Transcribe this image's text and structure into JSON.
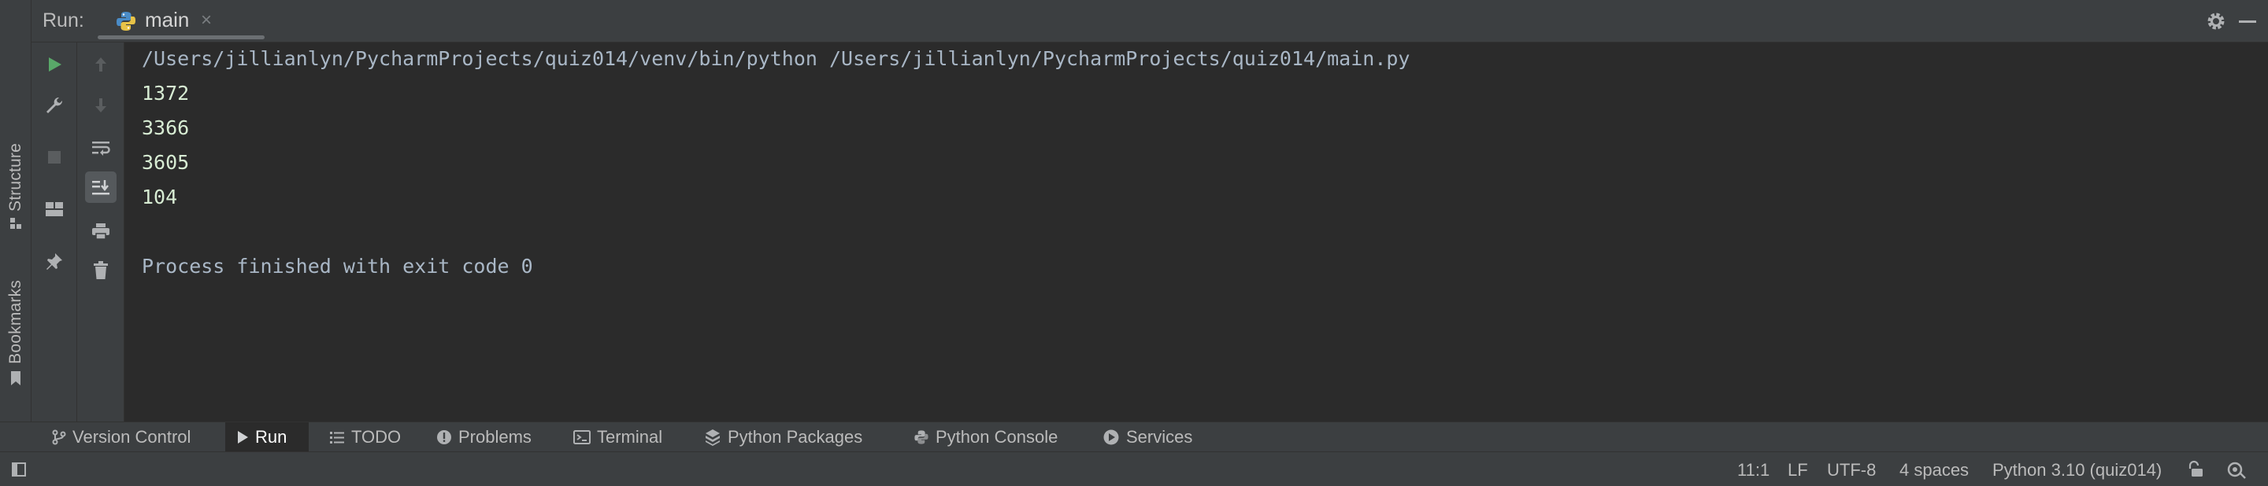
{
  "run_panel": {
    "label": "Run:",
    "tab": {
      "name": "main",
      "icon": "python-icon",
      "close": "×"
    }
  },
  "left_stripe": {
    "structure": "Structure",
    "bookmarks": "Bookmarks"
  },
  "toolbar": {
    "column1": [
      "rerun-icon",
      "wrench-icon",
      "stop-icon",
      "layout-icon",
      "pin-icon"
    ],
    "column2": [
      "arrow-up-icon",
      "arrow-down-icon",
      "soft-wrap-icon",
      "scroll-to-end-icon",
      "print-icon",
      "trash-icon"
    ]
  },
  "console": {
    "command": "/Users/jillianlyn/PycharmProjects/quiz014/venv/bin/python /Users/jillianlyn/PycharmProjects/quiz014/main.py",
    "outputs": [
      "1372",
      "3366",
      "3605",
      "104"
    ],
    "exit_message": "Process finished with exit code 0"
  },
  "bottom_tabs": [
    {
      "label": "Version Control",
      "icon": "branch-icon"
    },
    {
      "label": "Run",
      "icon": "play-icon",
      "active": true
    },
    {
      "label": "TODO",
      "icon": "list-icon"
    },
    {
      "label": "Problems",
      "icon": "problems-icon"
    },
    {
      "label": "Terminal",
      "icon": "terminal-icon"
    },
    {
      "label": "Python Packages",
      "icon": "packages-icon"
    },
    {
      "label": "Python Console",
      "icon": "python-icon"
    },
    {
      "label": "Services",
      "icon": "services-icon"
    }
  ],
  "status_bar": {
    "position": "11:1",
    "line_ending": "LF",
    "encoding": "UTF-8",
    "indent": "4 spaces",
    "interpreter": "Python 3.10 (quiz014)"
  },
  "colors": {
    "accent_green": "#59a869",
    "panel": "#3c3f41",
    "editor_bg": "#2b2b2b",
    "output_text": "#d7ecd3"
  }
}
